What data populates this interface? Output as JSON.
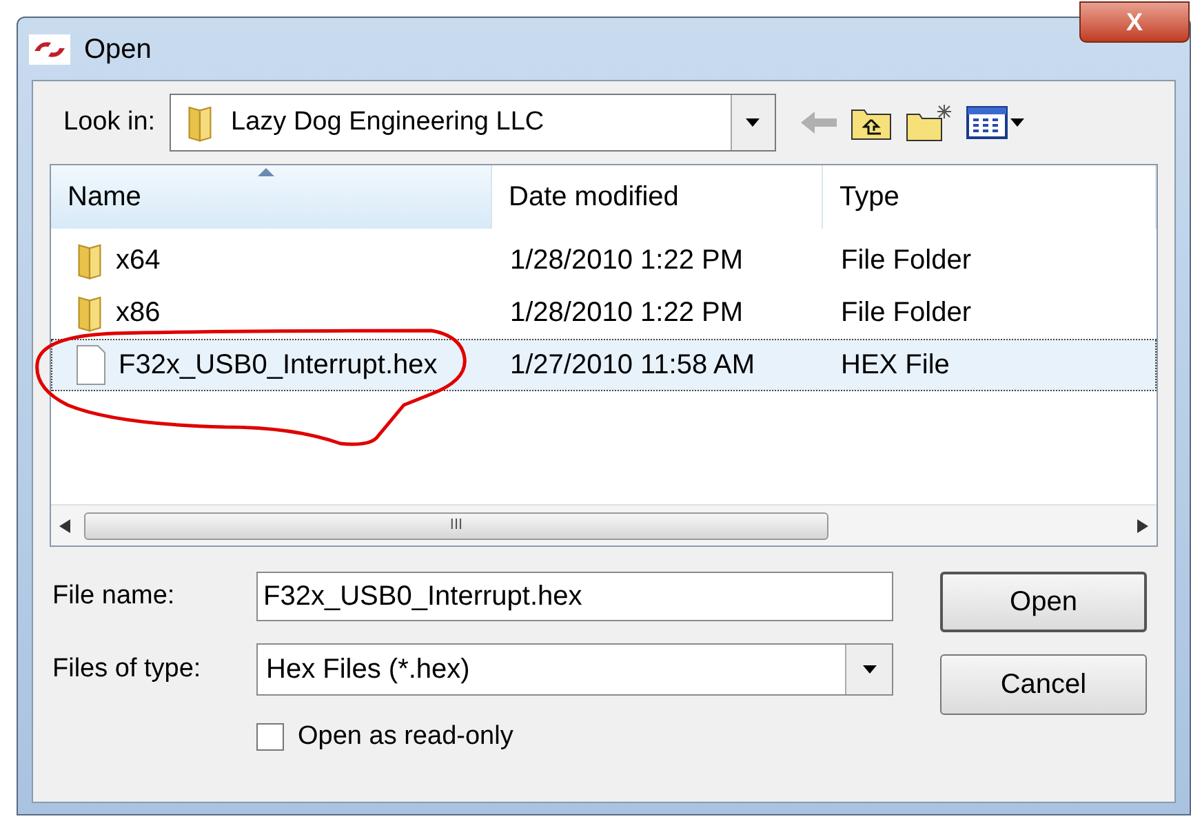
{
  "window": {
    "title": "Open",
    "close_label": "X"
  },
  "look_in": {
    "label": "Look in:",
    "value": "Lazy Dog Engineering LLC"
  },
  "file_list": {
    "columns": [
      {
        "label": "Name",
        "sorted": true
      },
      {
        "label": "Date modified",
        "sorted": false
      },
      {
        "label": "Type",
        "sorted": false
      }
    ],
    "rows": [
      {
        "kind": "folder",
        "name": "x64",
        "date": "1/28/2010 1:22 PM",
        "type": "File Folder",
        "selected": false
      },
      {
        "kind": "folder",
        "name": "x86",
        "date": "1/28/2010 1:22 PM",
        "type": "File Folder",
        "selected": false
      },
      {
        "kind": "file",
        "name": "F32x_USB0_Interrupt.hex",
        "date": "1/27/2010 11:58 AM",
        "type": "HEX File",
        "selected": true
      }
    ],
    "scrollbar_grip": "III"
  },
  "file_name": {
    "label": "File name:",
    "value": "F32x_USB0_Interrupt.hex"
  },
  "file_type": {
    "label": "Files of type:",
    "value": "Hex Files (*.hex)"
  },
  "read_only": {
    "label": "Open as read-only",
    "checked": false
  },
  "buttons": [
    {
      "label": "Open",
      "default": true
    },
    {
      "label": "Cancel",
      "default": false
    }
  ]
}
